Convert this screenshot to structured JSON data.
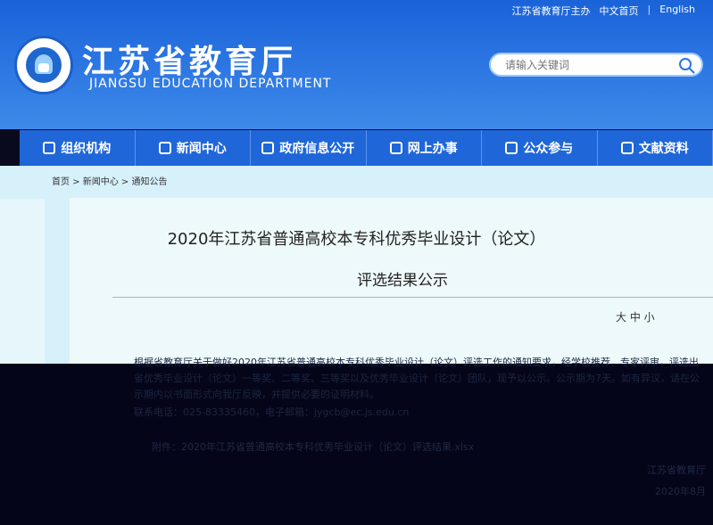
{
  "topbar": {
    "sponsor": "江苏省教育厅主办",
    "lang_cn": "中文首页",
    "divider": "|",
    "lang_en": "English"
  },
  "site": {
    "title": "江苏省教育厅",
    "subtitle": "JIANGSU EDUCATION DEPARTMENT"
  },
  "search": {
    "placeholder": "请输入关键词"
  },
  "nav": {
    "items": [
      {
        "label": "组织机构",
        "icon": "org-icon"
      },
      {
        "label": "新闻中心",
        "icon": "news-icon"
      },
      {
        "label": "政府信息公开",
        "icon": "info-icon"
      },
      {
        "label": "网上办事",
        "icon": "service-icon"
      },
      {
        "label": "公众参与",
        "icon": "public-icon"
      },
      {
        "label": "文献资料",
        "icon": "docs-icon"
      }
    ]
  },
  "breadcrumb": {
    "text": "首页 > 新闻中心 > 通知公告"
  },
  "article": {
    "title_line1": "2020年江苏省普通高校本专科优秀毕业设计（论文）",
    "title_line2": "评选结果公示",
    "font_size_label": "大 中 小",
    "paragraph1": "根据省教育厅关于做好2020年江苏省普通高校本专科优秀毕业设计（论文）评选工作的通知要求，经学校推荐、专家评审，评选出省优秀毕业设计（论文）一等奖、二等奖、三等奖以及优秀毕业设计（论文）团队，现予以公示。公示期为7天。如有异议，请在公示期内以书面形式向我厅反映，并提供必要的证明材料。",
    "paragraph2": "联系电话：025-83335460，电子邮箱：jygcb@ec.js.edu.cn",
    "attachment": "附件：2020年江苏省普通高校本专科优秀毕业设计（论文）评选结果.xlsx",
    "signature": "江苏省教育厅",
    "date": "2020年8月"
  }
}
